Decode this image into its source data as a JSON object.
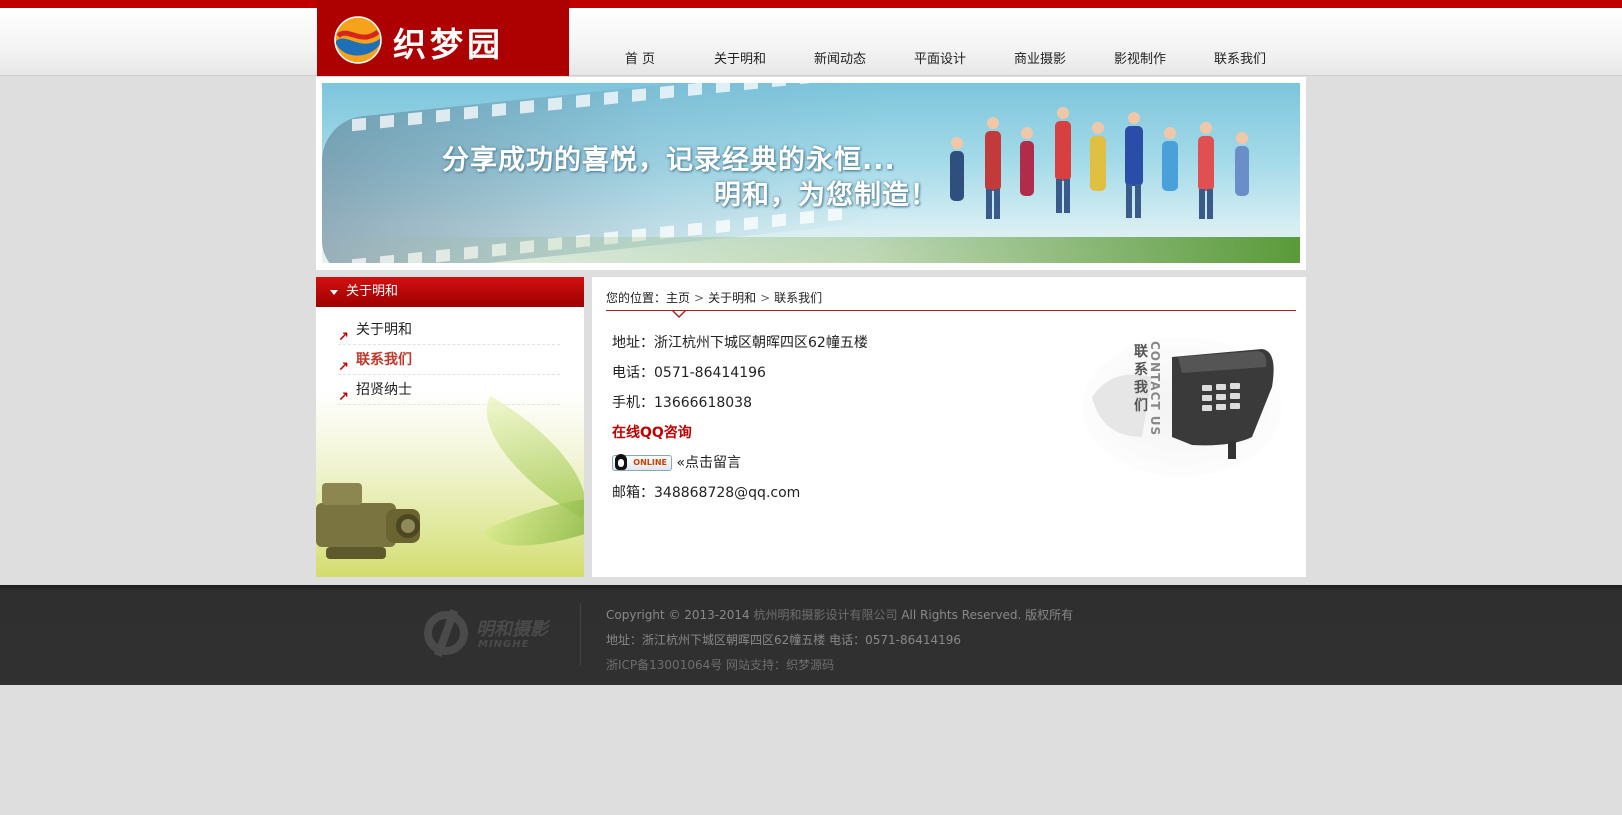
{
  "logo": {
    "text": "织梦园"
  },
  "nav": {
    "items": [
      {
        "label": "首 页"
      },
      {
        "label": "关于明和"
      },
      {
        "label": "新闻动态"
      },
      {
        "label": "平面设计"
      },
      {
        "label": "商业摄影"
      },
      {
        "label": "影视制作"
      },
      {
        "label": "联系我们"
      }
    ]
  },
  "banner": {
    "line1": "分享成功的喜悦，记录经典的永恒...",
    "line2": "明和，为您制造！"
  },
  "sidebar": {
    "title": "关于明和",
    "items": [
      {
        "label": "关于明和"
      },
      {
        "label": "联系我们"
      },
      {
        "label": "招贤纳士"
      }
    ]
  },
  "breadcrumb": {
    "prefix": "您的位置：",
    "home": "主页",
    "section": "关于明和",
    "current": "联系我们"
  },
  "contact": {
    "address": "地址：浙江杭州下城区朝晖四区62幢五楼",
    "phone": "电话：0571-86414196",
    "mobile": "手机：13666618038",
    "qq_title": "在线QQ咨询",
    "qq_badge": "ONLINE",
    "message_link": "«点击留言",
    "email": "邮箱：348868728@qq.com",
    "graphic_cn": "联系我们",
    "graphic_en": "CONTACT US"
  },
  "footer": {
    "logo_text": "明和摄影",
    "logo_sub": "MINGHE",
    "copyright_prefix": "Copyright © 2013-2014 ",
    "company": "杭州明和摄影设计有限公司",
    "copyright_suffix": " All Rights Reserved. 版权所有",
    "address_line": "地址：浙江杭州下城区朝晖四区62幢五楼 电话：0571-86414196",
    "icp": "浙ICP备13001064号",
    "support_prefix": " 网站支持：",
    "support_link": "织梦源码"
  }
}
